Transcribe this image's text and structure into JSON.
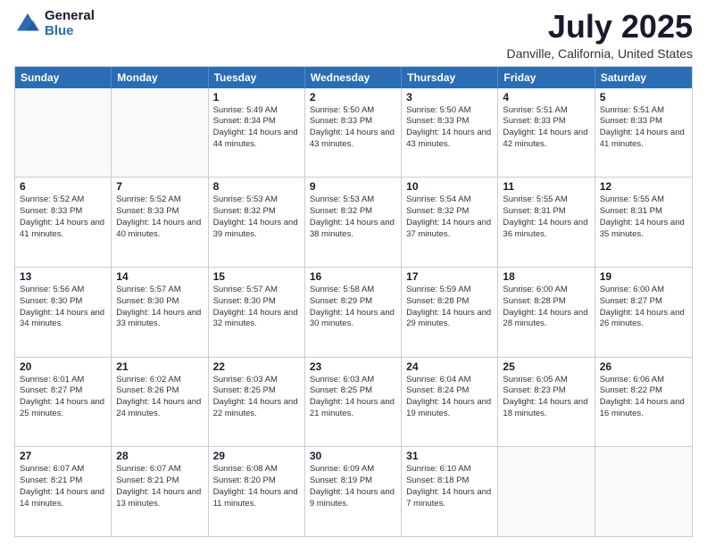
{
  "logo": {
    "general": "General",
    "blue": "Blue"
  },
  "title": "July 2025",
  "location": "Danville, California, United States",
  "weekdays": [
    "Sunday",
    "Monday",
    "Tuesday",
    "Wednesday",
    "Thursday",
    "Friday",
    "Saturday"
  ],
  "weeks": [
    [
      {
        "day": "",
        "empty": true
      },
      {
        "day": "",
        "empty": true
      },
      {
        "day": "1",
        "sunrise": "Sunrise: 5:49 AM",
        "sunset": "Sunset: 8:34 PM",
        "daylight": "Daylight: 14 hours and 44 minutes."
      },
      {
        "day": "2",
        "sunrise": "Sunrise: 5:50 AM",
        "sunset": "Sunset: 8:33 PM",
        "daylight": "Daylight: 14 hours and 43 minutes."
      },
      {
        "day": "3",
        "sunrise": "Sunrise: 5:50 AM",
        "sunset": "Sunset: 8:33 PM",
        "daylight": "Daylight: 14 hours and 43 minutes."
      },
      {
        "day": "4",
        "sunrise": "Sunrise: 5:51 AM",
        "sunset": "Sunset: 8:33 PM",
        "daylight": "Daylight: 14 hours and 42 minutes."
      },
      {
        "day": "5",
        "sunrise": "Sunrise: 5:51 AM",
        "sunset": "Sunset: 8:33 PM",
        "daylight": "Daylight: 14 hours and 41 minutes."
      }
    ],
    [
      {
        "day": "6",
        "sunrise": "Sunrise: 5:52 AM",
        "sunset": "Sunset: 8:33 PM",
        "daylight": "Daylight: 14 hours and 41 minutes."
      },
      {
        "day": "7",
        "sunrise": "Sunrise: 5:52 AM",
        "sunset": "Sunset: 8:33 PM",
        "daylight": "Daylight: 14 hours and 40 minutes."
      },
      {
        "day": "8",
        "sunrise": "Sunrise: 5:53 AM",
        "sunset": "Sunset: 8:32 PM",
        "daylight": "Daylight: 14 hours and 39 minutes."
      },
      {
        "day": "9",
        "sunrise": "Sunrise: 5:53 AM",
        "sunset": "Sunset: 8:32 PM",
        "daylight": "Daylight: 14 hours and 38 minutes."
      },
      {
        "day": "10",
        "sunrise": "Sunrise: 5:54 AM",
        "sunset": "Sunset: 8:32 PM",
        "daylight": "Daylight: 14 hours and 37 minutes."
      },
      {
        "day": "11",
        "sunrise": "Sunrise: 5:55 AM",
        "sunset": "Sunset: 8:31 PM",
        "daylight": "Daylight: 14 hours and 36 minutes."
      },
      {
        "day": "12",
        "sunrise": "Sunrise: 5:55 AM",
        "sunset": "Sunset: 8:31 PM",
        "daylight": "Daylight: 14 hours and 35 minutes."
      }
    ],
    [
      {
        "day": "13",
        "sunrise": "Sunrise: 5:56 AM",
        "sunset": "Sunset: 8:30 PM",
        "daylight": "Daylight: 14 hours and 34 minutes."
      },
      {
        "day": "14",
        "sunrise": "Sunrise: 5:57 AM",
        "sunset": "Sunset: 8:30 PM",
        "daylight": "Daylight: 14 hours and 33 minutes."
      },
      {
        "day": "15",
        "sunrise": "Sunrise: 5:57 AM",
        "sunset": "Sunset: 8:30 PM",
        "daylight": "Daylight: 14 hours and 32 minutes."
      },
      {
        "day": "16",
        "sunrise": "Sunrise: 5:58 AM",
        "sunset": "Sunset: 8:29 PM",
        "daylight": "Daylight: 14 hours and 30 minutes."
      },
      {
        "day": "17",
        "sunrise": "Sunrise: 5:59 AM",
        "sunset": "Sunset: 8:28 PM",
        "daylight": "Daylight: 14 hours and 29 minutes."
      },
      {
        "day": "18",
        "sunrise": "Sunrise: 6:00 AM",
        "sunset": "Sunset: 8:28 PM",
        "daylight": "Daylight: 14 hours and 28 minutes."
      },
      {
        "day": "19",
        "sunrise": "Sunrise: 6:00 AM",
        "sunset": "Sunset: 8:27 PM",
        "daylight": "Daylight: 14 hours and 26 minutes."
      }
    ],
    [
      {
        "day": "20",
        "sunrise": "Sunrise: 6:01 AM",
        "sunset": "Sunset: 8:27 PM",
        "daylight": "Daylight: 14 hours and 25 minutes."
      },
      {
        "day": "21",
        "sunrise": "Sunrise: 6:02 AM",
        "sunset": "Sunset: 8:26 PM",
        "daylight": "Daylight: 14 hours and 24 minutes."
      },
      {
        "day": "22",
        "sunrise": "Sunrise: 6:03 AM",
        "sunset": "Sunset: 8:25 PM",
        "daylight": "Daylight: 14 hours and 22 minutes."
      },
      {
        "day": "23",
        "sunrise": "Sunrise: 6:03 AM",
        "sunset": "Sunset: 8:25 PM",
        "daylight": "Daylight: 14 hours and 21 minutes."
      },
      {
        "day": "24",
        "sunrise": "Sunrise: 6:04 AM",
        "sunset": "Sunset: 8:24 PM",
        "daylight": "Daylight: 14 hours and 19 minutes."
      },
      {
        "day": "25",
        "sunrise": "Sunrise: 6:05 AM",
        "sunset": "Sunset: 8:23 PM",
        "daylight": "Daylight: 14 hours and 18 minutes."
      },
      {
        "day": "26",
        "sunrise": "Sunrise: 6:06 AM",
        "sunset": "Sunset: 8:22 PM",
        "daylight": "Daylight: 14 hours and 16 minutes."
      }
    ],
    [
      {
        "day": "27",
        "sunrise": "Sunrise: 6:07 AM",
        "sunset": "Sunset: 8:21 PM",
        "daylight": "Daylight: 14 hours and 14 minutes."
      },
      {
        "day": "28",
        "sunrise": "Sunrise: 6:07 AM",
        "sunset": "Sunset: 8:21 PM",
        "daylight": "Daylight: 14 hours and 13 minutes."
      },
      {
        "day": "29",
        "sunrise": "Sunrise: 6:08 AM",
        "sunset": "Sunset: 8:20 PM",
        "daylight": "Daylight: 14 hours and 11 minutes."
      },
      {
        "day": "30",
        "sunrise": "Sunrise: 6:09 AM",
        "sunset": "Sunset: 8:19 PM",
        "daylight": "Daylight: 14 hours and 9 minutes."
      },
      {
        "day": "31",
        "sunrise": "Sunrise: 6:10 AM",
        "sunset": "Sunset: 8:18 PM",
        "daylight": "Daylight: 14 hours and 7 minutes."
      },
      {
        "day": "",
        "empty": true
      },
      {
        "day": "",
        "empty": true
      }
    ]
  ]
}
